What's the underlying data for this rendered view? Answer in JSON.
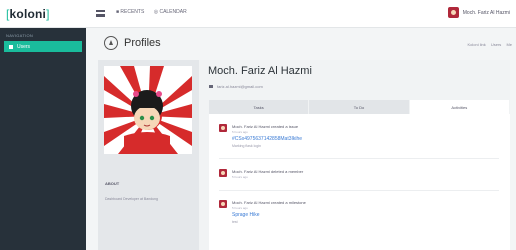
{
  "app": {
    "logo": "koloni"
  },
  "topbar": {
    "nav": [
      "■ RECENTS",
      "◎ CALENDAR"
    ],
    "user_name": "Moch. Fariz Al Hazmi"
  },
  "sidebar": {
    "section": "NAVIGATION",
    "items": [
      {
        "label": "Users",
        "active": true
      }
    ]
  },
  "page": {
    "title": "Profiles",
    "breadcrumb": [
      "Koloni link",
      "Users",
      "Me"
    ]
  },
  "profile": {
    "name": "Moch. Fariz Al Hazmi",
    "email": "fariz.al.hazmi@gmail.com",
    "about_heading": "ABOUT",
    "about_text": "Dashboard Developer at Bandung"
  },
  "tabs": [
    {
      "label": "Tasks"
    },
    {
      "label": "To Do"
    },
    {
      "label": "Activities",
      "active": true
    }
  ],
  "activities": [
    {
      "actor": "Moch. Fariz Al Hazmi",
      "action": "created a issue",
      "time": "5 hours ago",
      "link": "#CSx4975637142858Mat3Ikihe",
      "sub": "Marking flask login"
    },
    {
      "actor": "Moch. Fariz Al Hazmi",
      "action": "deleted a member",
      "time": "5 hours ago"
    },
    {
      "actor": "Moch. Fariz Al Hazmi",
      "action": "created a milestone",
      "time": "5 hours ago",
      "link": "Sprage Hike",
      "sub": "test"
    }
  ],
  "colors": {
    "accent": "#1abc9c",
    "sidebar_bg": "#27313a",
    "link": "#3a7bd5"
  }
}
